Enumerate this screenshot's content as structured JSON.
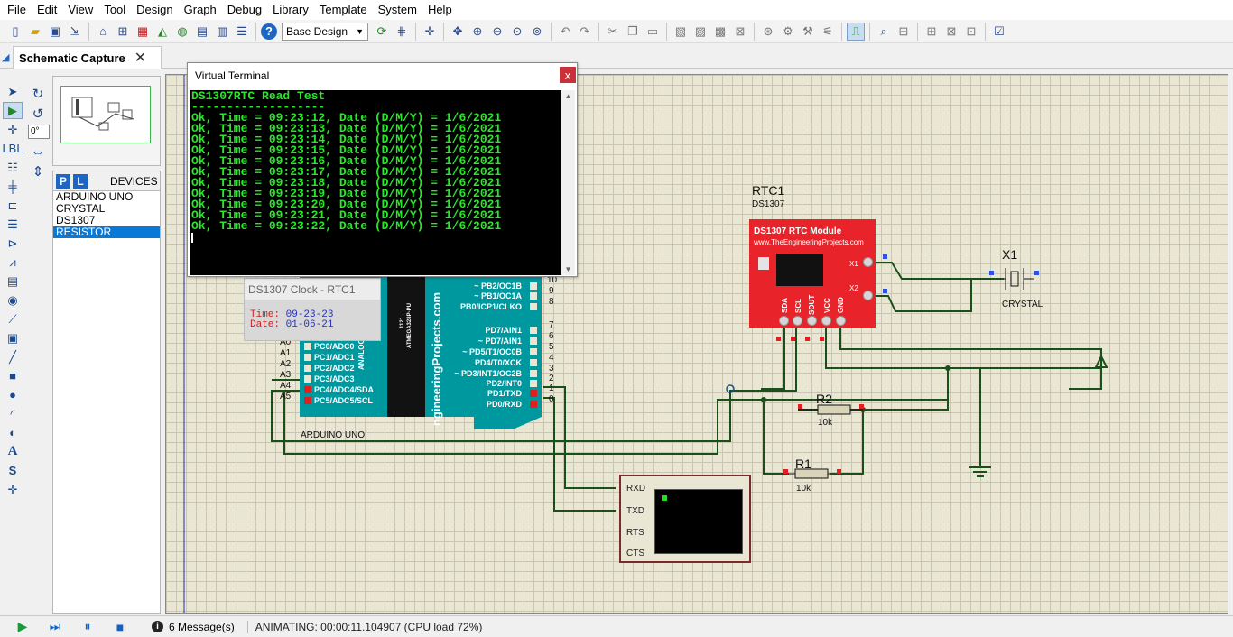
{
  "menu": [
    "File",
    "Edit",
    "View",
    "Tool",
    "Design",
    "Graph",
    "Debug",
    "Library",
    "Template",
    "System",
    "Help"
  ],
  "toolbar": {
    "design_select": "Base Design"
  },
  "tab": {
    "label": "Schematic Capture",
    "close": "✕"
  },
  "rotation": {
    "angle": "0°"
  },
  "devices": {
    "p_label": "P",
    "l_label": "L",
    "header": "DEVICES",
    "items": [
      "ARDUINO UNO",
      "CRYSTAL",
      "DS1307",
      "RESISTOR"
    ],
    "selected": "RESISTOR"
  },
  "virtual_terminal": {
    "title": "Virtual Terminal",
    "close": "x",
    "lines": [
      "DS1307RTC Read Test",
      "-------------------",
      "Ok, Time = 09:23:12, Date (D/M/Y) = 1/6/2021",
      "Ok, Time = 09:23:13, Date (D/M/Y) = 1/6/2021",
      "Ok, Time = 09:23:14, Date (D/M/Y) = 1/6/2021",
      "Ok, Time = 09:23:15, Date (D/M/Y) = 1/6/2021",
      "Ok, Time = 09:23:16, Date (D/M/Y) = 1/6/2021",
      "Ok, Time = 09:23:17, Date (D/M/Y) = 1/6/2021",
      "Ok, Time = 09:23:18, Date (D/M/Y) = 1/6/2021",
      "Ok, Time = 09:23:19, Date (D/M/Y) = 1/6/2021",
      "Ok, Time = 09:23:20, Date (D/M/Y) = 1/6/2021",
      "Ok, Time = 09:23:21, Date (D/M/Y) = 1/6/2021",
      "Ok, Time = 09:23:22, Date (D/M/Y) = 1/6/2021"
    ]
  },
  "clock_popup": {
    "title": "DS1307 Clock - RTC1",
    "time_label": "Time:",
    "time_value": "09-23-23",
    "date_label": "Date:",
    "date_value": "01-06-21"
  },
  "arduino": {
    "name": "ARDUINO UNO",
    "site": "ngineeringProjects.com",
    "chip_label": "ATMEGA328P-PU",
    "chip_num": "1121",
    "analog_group": "ANALOG IN",
    "right_pins": [
      "~ PB2/OC1B",
      "~ PB1/OC1A",
      "PB0/ICP1/CLKO",
      "PD7/AIN1",
      "~ PD7/AIN1",
      "~ PD5/T1/OC0B",
      "PD4/T0/XCK",
      "~ PD3/INT1/OC2B",
      "PD2/INT0",
      "PD1/TXD",
      "PD0/RXD"
    ],
    "right_nums": [
      "10",
      "9",
      "8",
      "7",
      "6",
      "5",
      "4",
      "3",
      "2",
      "1",
      "0"
    ],
    "left_pins": [
      "PC0/ADC0",
      "PC1/ADC1",
      "PC2/ADC2",
      "PC3/ADC3",
      "PC4/ADC4/SDA",
      "PC5/ADC5/SCL"
    ],
    "left_nums": [
      "A0",
      "A1",
      "A2",
      "A3",
      "A4",
      "A5"
    ]
  },
  "rtc": {
    "ref": "RTC1",
    "part": "DS1307",
    "title": "DS1307 RTC Module",
    "site": "www.TheEngineeringProjects.com",
    "x1": "X1",
    "x2": "X2",
    "bottom_pins": [
      "SDA",
      "SCL",
      "SOUT",
      "VCC",
      "GND"
    ]
  },
  "crystal": {
    "ref": "X1",
    "name": "CRYSTAL"
  },
  "r2": {
    "ref": "R2",
    "value": "10k"
  },
  "r1": {
    "ref": "R1",
    "value": "10k"
  },
  "serial": {
    "pins": [
      "RXD",
      "TXD",
      "RTS",
      "CTS"
    ]
  },
  "status": {
    "messages": "6 Message(s)",
    "animating": "ANIMATING: 00:00:11.104907 (CPU load 72%)"
  }
}
